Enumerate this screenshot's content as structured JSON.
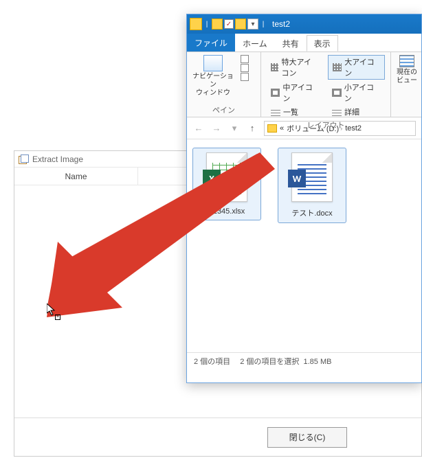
{
  "extract": {
    "title": "Extract Image",
    "cols": {
      "name": "Name"
    },
    "close_label": "閉じる(C)"
  },
  "explorer": {
    "title": "test2",
    "tabs": {
      "file": "ファイル",
      "home": "ホーム",
      "share": "共有",
      "view": "表示"
    },
    "ribbon": {
      "pane_group": "ペイン",
      "nav_pane": "ナビゲーション\nウィンドウ",
      "layout_group": "レイアウト",
      "xl_icon": "特大アイコン",
      "lg_icon": "大アイコン",
      "md_icon": "中アイコン",
      "sm_icon": "小アイコン",
      "list": "一覧",
      "details": "詳細",
      "current_view": "現在の\nビュー"
    },
    "addr": {
      "volume": "ボリューム (D:)",
      "folder": "test2",
      "sep": "›",
      "ellipsis": "«"
    },
    "files": [
      {
        "name": "12345.xlsx",
        "kind": "xl",
        "badge": "X"
      },
      {
        "name": "テスト.docx",
        "kind": "wd",
        "badge": "W"
      }
    ],
    "status": {
      "count": "2 個の項目",
      "selected": "2 個の項目を選択",
      "size": "1.85 MB"
    }
  }
}
